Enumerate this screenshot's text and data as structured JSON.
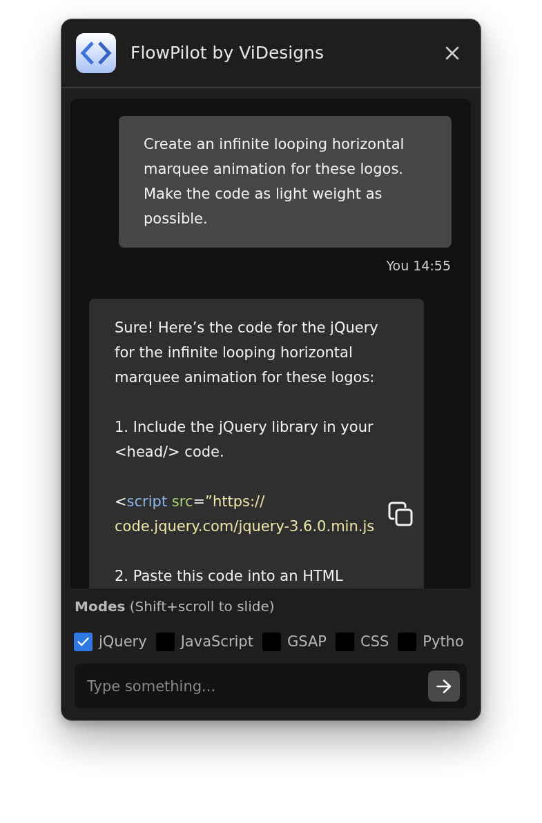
{
  "window": {
    "title": "FlowPilot by ViDesigns"
  },
  "messages": [
    {
      "kind": "user",
      "text": "Create an infinite looping horizontal\nmarquee animation for these logos.\nMake the code as light weight as\npossible.",
      "meta": "You 14:55"
    },
    {
      "kind": "assistant",
      "blocks": [
        {
          "kind": "text",
          "text": "Sure! Here’s the code for the jQuery\nfor the infinite looping horizontal\nmarquee animation for these logos:"
        },
        {
          "kind": "text",
          "text": "1. Include the jQuery library in your\n<head/> code."
        },
        {
          "kind": "code",
          "lines": [
            [
              {
                "kind": "punct",
                "text": "<"
              },
              {
                "kind": "tag",
                "text": "script"
              },
              {
                "kind": "attr",
                "text": " src"
              },
              {
                "kind": "punct",
                "text": "="
              },
              {
                "kind": "string",
                "text": "”https://"
              }
            ],
            [
              {
                "kind": "string",
                "text": "code.jquery.com/jquery-3.6.0.min.js"
              }
            ]
          ]
        },
        {
          "kind": "text",
          "text": "2. Paste this code into an HTML"
        }
      ]
    }
  ],
  "modes": {
    "label": "**Modes** (Shift+scroll to slide)",
    "options": [
      {
        "label": "jQuery",
        "checked": true
      },
      {
        "label": "JavaScript",
        "checked": false
      },
      {
        "label": "GSAP",
        "checked": false
      },
      {
        "label": "CSS",
        "checked": false
      },
      {
        "label": "Pytho",
        "checked": false
      }
    ]
  },
  "composer": {
    "placeholder": "Type something..."
  }
}
